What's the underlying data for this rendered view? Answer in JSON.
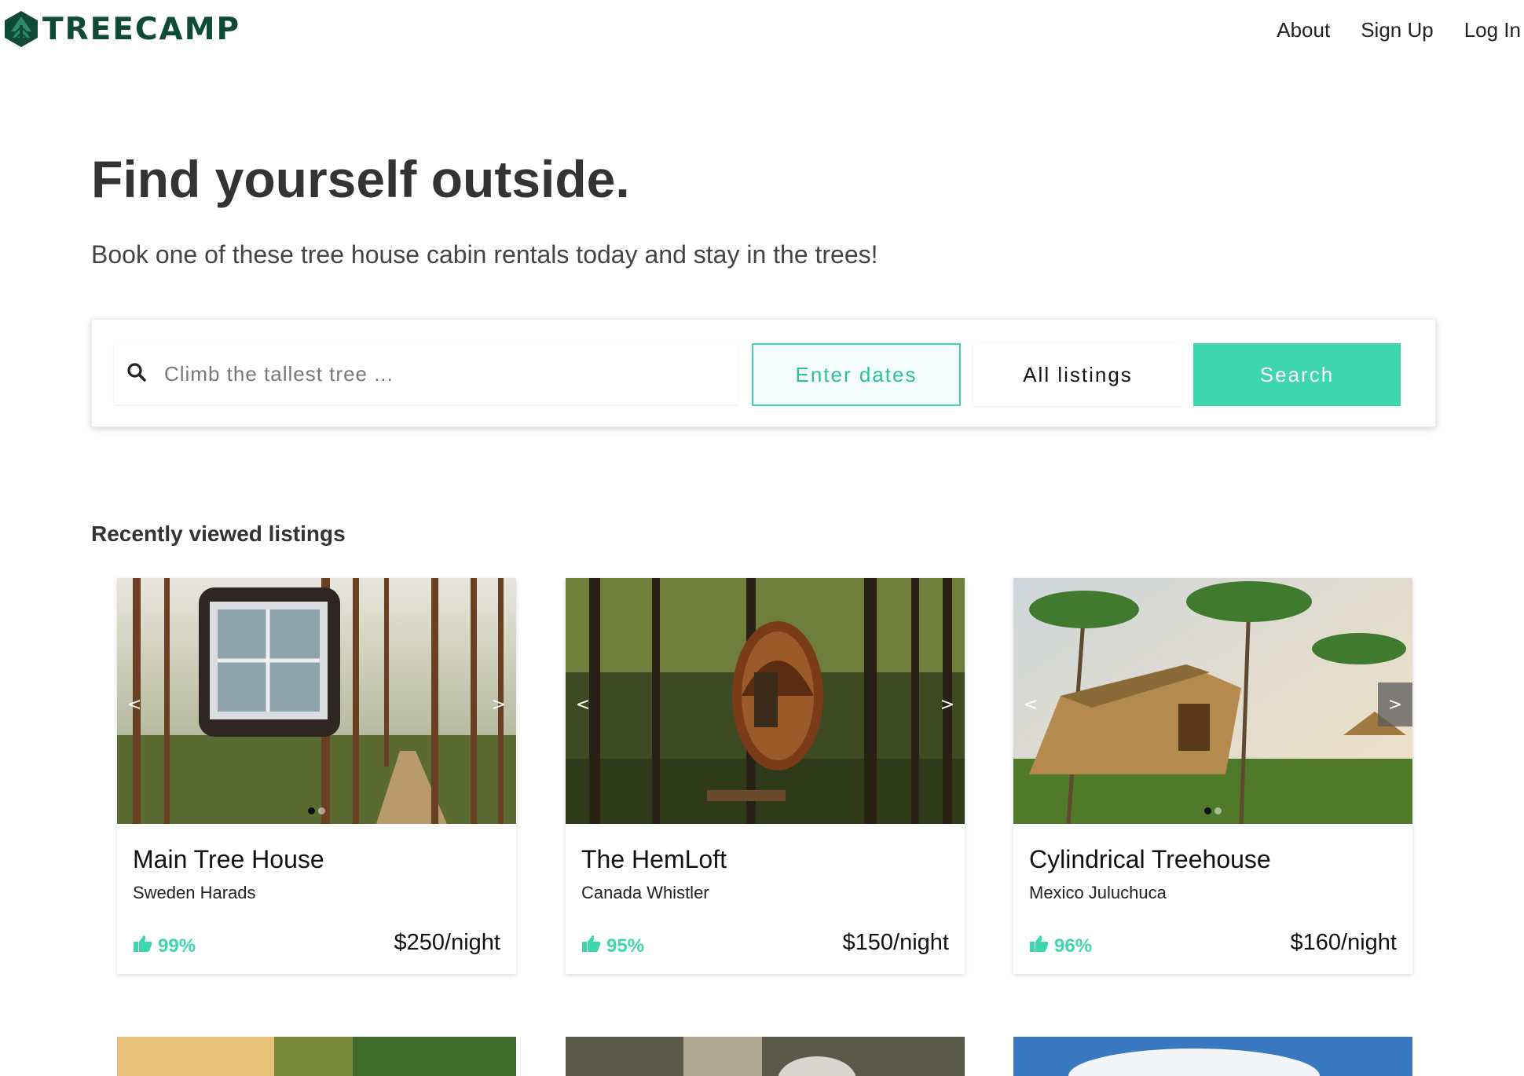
{
  "brand": {
    "name": "TREECAMP",
    "color": "#0e4a37",
    "accent": "#3dd6ad"
  },
  "nav": {
    "about": "About",
    "signup": "Sign Up",
    "login": "Log In"
  },
  "hero": {
    "title": "Find yourself outside.",
    "subtitle": "Book one of these tree house cabin rentals today and stay in the trees!"
  },
  "search": {
    "placeholder": "Climb the tallest tree ...",
    "dates_label": "Enter dates",
    "listings_label": "All listings",
    "search_label": "Search"
  },
  "recent": {
    "title": "Recently viewed listings",
    "cards": [
      {
        "name": "Main Tree House",
        "location": "Sweden Harads",
        "rating": "99%",
        "price": "$250/night",
        "image": "cube-treehouse-pine-forest",
        "prev": "<",
        "next": ">"
      },
      {
        "name": "The HemLoft",
        "location": "Canada Whistler",
        "rating": "95%",
        "price": "$150/night",
        "image": "egg-treehouse-forest",
        "prev": "<",
        "next": ">"
      },
      {
        "name": "Cylindrical Treehouse",
        "location": "Mexico Juluchuca",
        "rating": "96%",
        "price": "$160/night",
        "image": "bamboo-treehouse-palms",
        "prev": "<",
        "next": ">"
      }
    ]
  }
}
